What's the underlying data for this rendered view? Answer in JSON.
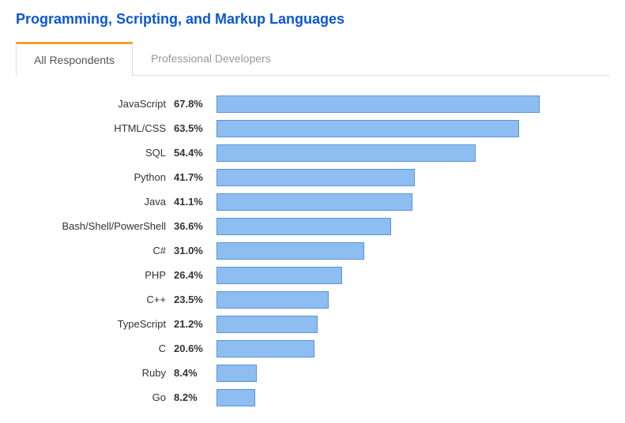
{
  "title": "Programming, Scripting, and Markup Languages",
  "tabs": [
    {
      "label": "All Respondents",
      "active": true
    },
    {
      "label": "Professional Developers",
      "active": false
    }
  ],
  "chart_data": {
    "type": "bar",
    "title": "Programming, Scripting, and Markup Languages",
    "xlabel": "",
    "ylabel": "",
    "xlim": [
      0,
      70
    ],
    "categories": [
      "JavaScript",
      "HTML/CSS",
      "SQL",
      "Python",
      "Java",
      "Bash/Shell/PowerShell",
      "C#",
      "PHP",
      "C++",
      "TypeScript",
      "C",
      "Ruby",
      "Go"
    ],
    "values": [
      67.8,
      63.5,
      54.4,
      41.7,
      41.1,
      36.6,
      31.0,
      26.4,
      23.5,
      21.2,
      20.6,
      8.4,
      8.2
    ],
    "value_labels": [
      "67.8%",
      "63.5%",
      "54.4%",
      "41.7%",
      "41.1%",
      "36.6%",
      "31.0%",
      "26.4%",
      "23.5%",
      "21.2%",
      "20.6%",
      "8.4%",
      "8.2%"
    ]
  }
}
